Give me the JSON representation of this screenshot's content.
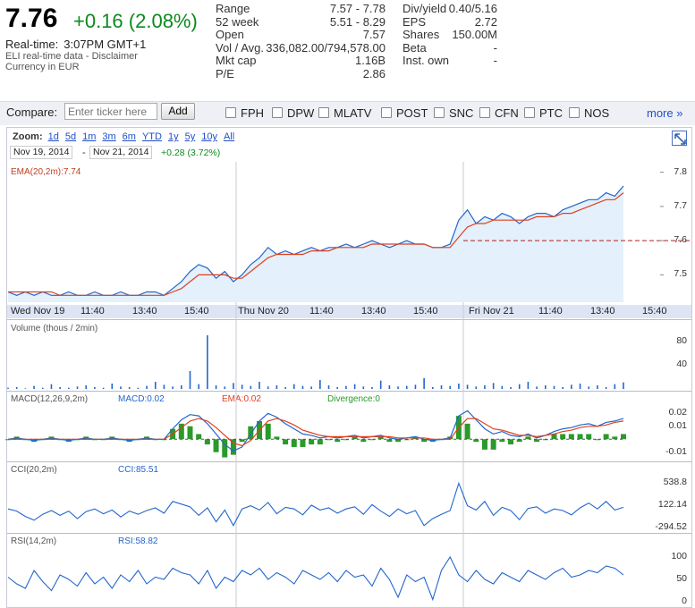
{
  "quote": {
    "price": "7.76",
    "change": "+0.16 (2.08%)",
    "realtime_label": "Real-time:",
    "realtime_time": "3:07PM GMT+1",
    "data_note": "ELI real-time data - Disclaimer",
    "currency_note": "Currency in EUR"
  },
  "stats_left": [
    {
      "label": "Range",
      "value": "7.57 - 7.78"
    },
    {
      "label": "52 week",
      "value": "5.51 - 8.29"
    },
    {
      "label": "Open",
      "value": "7.57"
    },
    {
      "label": "Vol / Avg.",
      "value": "336,082.00/794,578.00"
    },
    {
      "label": "Mkt cap",
      "value": "1.16B"
    },
    {
      "label": "P/E",
      "value": "2.86"
    }
  ],
  "stats_right": [
    {
      "label": "Div/yield",
      "value": "0.40/5.16"
    },
    {
      "label": "EPS",
      "value": "2.72"
    },
    {
      "label": "Shares",
      "value": "150.00M"
    },
    {
      "label": "Beta",
      "value": "-"
    },
    {
      "label": "Inst. own",
      "value": "-"
    }
  ],
  "compare": {
    "label": "Compare:",
    "placeholder": "Enter ticker here",
    "add_label": "Add",
    "tickers": [
      "FPH",
      "DPW",
      "MLATV",
      "POST",
      "SNC",
      "CFN",
      "PTC",
      "NOS"
    ],
    "more_label": "more »"
  },
  "zoom": {
    "label": "Zoom:",
    "options": [
      "1d",
      "5d",
      "1m",
      "3m",
      "6m",
      "YTD",
      "1y",
      "5y",
      "10y",
      "All"
    ]
  },
  "range": {
    "start": "Nov 19, 2014",
    "dash": "-",
    "end": "Nov 21, 2014",
    "change": "+0.28 (3.72%)"
  },
  "panels": {
    "price_label": "EMA(20,2m):7.74",
    "volume_label": "Volume (thous / 2min)",
    "macd_label": "MACD(12,26,9,2m)",
    "macd_value": "MACD:0.02",
    "ema_value": "EMA:0.02",
    "divergence_value": "Divergence:0",
    "cci_label": "CCI(20,2m)",
    "cci_value": "CCI:85.51",
    "rsi_label": "RSI(14,2m)",
    "rsi_value": "RSI:58.82"
  },
  "colors": {
    "price_line": "#2266cc",
    "ema_line": "#e0401e",
    "divergence": "#2a9a2a",
    "positive": "#0b8a1e",
    "link": "#2050c8",
    "prev_close_line": "#b02020"
  },
  "chart_data": [
    {
      "type": "line",
      "name": "price",
      "x_ticks": [
        "Wed Nov 19",
        "11:40",
        "13:40",
        "15:40",
        "Thu Nov 20",
        "11:40",
        "13:40",
        "15:40",
        "Fri Nov 21",
        "11:40",
        "13:40",
        "15:40"
      ],
      "y_ticks": [
        "7.8",
        "7.7",
        "7.6",
        "7.5"
      ],
      "ylim": [
        7.42,
        7.82
      ],
      "reference_line": 7.6,
      "series": [
        {
          "name": "Price",
          "values": [
            7.45,
            7.44,
            7.45,
            7.44,
            7.45,
            7.44,
            7.44,
            7.45,
            7.44,
            7.44,
            7.45,
            7.44,
            7.44,
            7.45,
            7.44,
            7.44,
            7.45,
            7.45,
            7.44,
            7.46,
            7.48,
            7.51,
            7.53,
            7.52,
            7.49,
            7.51,
            7.48,
            7.5,
            7.53,
            7.55,
            7.58,
            7.56,
            7.57,
            7.56,
            7.57,
            7.58,
            7.57,
            7.58,
            7.58,
            7.59,
            7.58,
            7.59,
            7.6,
            7.59,
            7.58,
            7.59,
            7.6,
            7.59,
            7.59,
            7.58,
            7.58,
            7.59,
            7.66,
            7.69,
            7.65,
            7.67,
            7.66,
            7.68,
            7.67,
            7.65,
            7.67,
            7.68,
            7.68,
            7.67,
            7.69,
            7.7,
            7.71,
            7.72,
            7.72,
            7.74,
            7.73,
            7.76
          ]
        },
        {
          "name": "EMA(20,2m)",
          "values": [
            7.45,
            7.45,
            7.45,
            7.45,
            7.45,
            7.45,
            7.44,
            7.44,
            7.44,
            7.44,
            7.44,
            7.44,
            7.44,
            7.44,
            7.44,
            7.44,
            7.44,
            7.44,
            7.44,
            7.45,
            7.46,
            7.48,
            7.5,
            7.5,
            7.5,
            7.5,
            7.49,
            7.49,
            7.51,
            7.53,
            7.55,
            7.56,
            7.56,
            7.56,
            7.56,
            7.57,
            7.57,
            7.57,
            7.58,
            7.58,
            7.58,
            7.58,
            7.59,
            7.59,
            7.59,
            7.59,
            7.59,
            7.59,
            7.59,
            7.58,
            7.58,
            7.58,
            7.61,
            7.64,
            7.65,
            7.65,
            7.66,
            7.66,
            7.66,
            7.66,
            7.66,
            7.67,
            7.67,
            7.67,
            7.68,
            7.68,
            7.69,
            7.7,
            7.71,
            7.72,
            7.72,
            7.74
          ]
        }
      ]
    },
    {
      "type": "bar",
      "name": "volume",
      "y_ticks": [
        "80",
        "40"
      ],
      "ylim": [
        0,
        90
      ],
      "values": [
        2,
        3,
        1,
        5,
        2,
        8,
        3,
        2,
        4,
        6,
        3,
        2,
        9,
        4,
        3,
        2,
        5,
        12,
        7,
        4,
        6,
        30,
        8,
        90,
        6,
        4,
        10,
        7,
        5,
        12,
        4,
        6,
        3,
        8,
        5,
        4,
        15,
        6,
        3,
        5,
        8,
        4,
        3,
        14,
        6,
        4,
        5,
        7,
        18,
        3,
        6,
        5,
        9,
        7,
        4,
        6,
        10,
        5,
        3,
        8,
        12,
        4,
        6,
        5,
        3,
        7,
        9,
        4,
        6,
        3,
        8,
        11
      ]
    },
    {
      "type": "line",
      "name": "macd",
      "y_ticks": [
        "0.02",
        "0.01",
        "-0.01"
      ],
      "ylim": [
        -0.015,
        0.025
      ],
      "series": [
        {
          "name": "MACD",
          "values": [
            0,
            0.001,
            0,
            -0.001,
            0,
            0.001,
            0,
            -0.001,
            0,
            0.001,
            0,
            0,
            0.001,
            0,
            -0.001,
            0,
            0.001,
            0,
            0,
            0.008,
            0.015,
            0.019,
            0.018,
            0.012,
            0.004,
            -0.004,
            -0.009,
            -0.006,
            0.004,
            0.014,
            0.02,
            0.017,
            0.012,
            0.008,
            0.004,
            0.003,
            0.001,
            0.002,
            0.001,
            0.002,
            0.003,
            0.001,
            0.002,
            0.003,
            0.001,
            0,
            0.001,
            0.002,
            0,
            -0.001,
            0,
            0.001,
            0.018,
            0.022,
            0.015,
            0.008,
            0.004,
            0.006,
            0.003,
            0.002,
            0.004,
            0.001,
            0.003,
            0.006,
            0.008,
            0.009,
            0.011,
            0.012,
            0.01,
            0.013,
            0.014,
            0.016
          ]
        },
        {
          "name": "EMA",
          "values": [
            0,
            0,
            0,
            0,
            0,
            0,
            0,
            0,
            0,
            0,
            0,
            0,
            0,
            0,
            0,
            0,
            0,
            0,
            0,
            0.004,
            0.009,
            0.014,
            0.016,
            0.014,
            0.009,
            0.003,
            -0.003,
            -0.005,
            -0.001,
            0.007,
            0.014,
            0.016,
            0.014,
            0.011,
            0.007,
            0.005,
            0.003,
            0.002,
            0.002,
            0.002,
            0.002,
            0.002,
            0.002,
            0.002,
            0.002,
            0.001,
            0.001,
            0.001,
            0.001,
            0,
            0,
            0,
            0.009,
            0.016,
            0.016,
            0.012,
            0.008,
            0.007,
            0.005,
            0.003,
            0.003,
            0.002,
            0.003,
            0.004,
            0.006,
            0.007,
            0.009,
            0.01,
            0.01,
            0.011,
            0.013,
            0.014
          ]
        }
      ]
    },
    {
      "type": "line",
      "name": "cci",
      "y_ticks": [
        "538.8",
        "122.14",
        "-294.52"
      ],
      "ylim": [
        -320,
        580
      ],
      "values": [
        60,
        20,
        -80,
        -150,
        -40,
        30,
        -60,
        20,
        -120,
        10,
        60,
        -30,
        40,
        -90,
        20,
        -40,
        30,
        80,
        -20,
        200,
        150,
        100,
        -60,
        80,
        -180,
        40,
        -250,
        60,
        120,
        40,
        180,
        -30,
        90,
        60,
        -50,
        130,
        40,
        80,
        -20,
        60,
        100,
        -40,
        140,
        20,
        -80,
        60,
        -30,
        30,
        -250,
        -120,
        -40,
        30,
        538,
        120,
        40,
        200,
        -60,
        90,
        30,
        -140,
        70,
        100,
        -20,
        60,
        30,
        -50,
        80,
        170,
        60,
        200,
        40,
        90
      ]
    },
    {
      "type": "line",
      "name": "rsi",
      "y_ticks": [
        "100",
        "50",
        "0"
      ],
      "ylim": [
        0,
        110
      ],
      "values": [
        55,
        40,
        30,
        70,
        45,
        25,
        60,
        50,
        35,
        65,
        40,
        55,
        30,
        60,
        45,
        70,
        40,
        55,
        50,
        75,
        65,
        60,
        40,
        70,
        30,
        55,
        45,
        70,
        60,
        75,
        50,
        65,
        55,
        40,
        70,
        60,
        50,
        65,
        45,
        70,
        55,
        60,
        35,
        75,
        50,
        10,
        60,
        45,
        55,
        5,
        70,
        100,
        60,
        45,
        70,
        50,
        40,
        65,
        55,
        45,
        70,
        60,
        50,
        65,
        75,
        55,
        60,
        70,
        65,
        80,
        75,
        60
      ]
    }
  ]
}
